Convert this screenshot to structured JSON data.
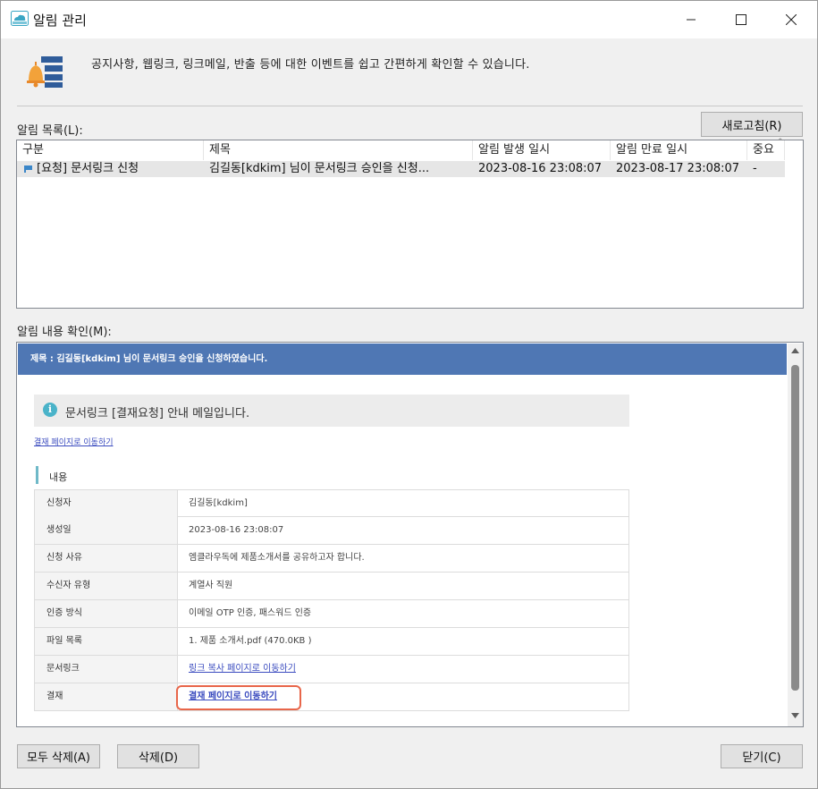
{
  "window": {
    "title": "알림 관리"
  },
  "header": {
    "description": "공지사항, 웹링크, 링크메일, 반출 등에 대한 이벤트를 쉽고 간편하게 확인할 수 있습니다."
  },
  "alert_list": {
    "label": "알림 목록(L):",
    "refresh_button": "새로고침(R)",
    "columns": [
      "구분",
      "제목",
      "알림 발생 일시",
      "알림 만료 일시",
      "중요"
    ],
    "rows": [
      {
        "category": "[요청] 문서링크 신청",
        "subject": "김길동[kdkim] 님이 문서링크 승인을 신청...",
        "created": "2023-08-16 23:08:07",
        "expires": "2023-08-17 23:08:07",
        "important": "-"
      }
    ]
  },
  "content": {
    "label": "알림 내용 확인(M):",
    "title_bar": "제목 : 김길동[kdkim] 님이 문서링크 승인을 신청하였습니다.",
    "notice": "문서링크 [결재요청] 안내 메일입니다.",
    "approval_link_top": "결재 페이지로 이동하기",
    "section_title": "내용",
    "details": [
      {
        "key": "신청자",
        "value": "김길동[kdkim]"
      },
      {
        "key": "생성일",
        "value": "2023-08-16 23:08:07"
      },
      {
        "key": "신청 사유",
        "value": "엠클라우독에 제품소개서를 공유하고자 합니다."
      },
      {
        "key": "수신자 유형",
        "value": "계열사 직원"
      },
      {
        "key": "인증 방식",
        "value": "이메일 OTP 인증, 패스워드 인증"
      },
      {
        "key": "파일 목록",
        "value": "1. 제품 소개서.pdf (470.0KB )"
      },
      {
        "key": "문서링크",
        "value": "링크 복사 페이지로 이동하기"
      },
      {
        "key": "결재",
        "value": "결재 페이지로 이동하기"
      }
    ]
  },
  "footer": {
    "delete_all": "모두 삭제(A)",
    "delete": "삭제(D)",
    "close": "닫기(C)"
  },
  "colors": {
    "viewer_title_bg": "#4f77b4",
    "highlight": "#e8664a",
    "link": "#3a4bbf",
    "accent_bar": "#6fb9c8"
  }
}
